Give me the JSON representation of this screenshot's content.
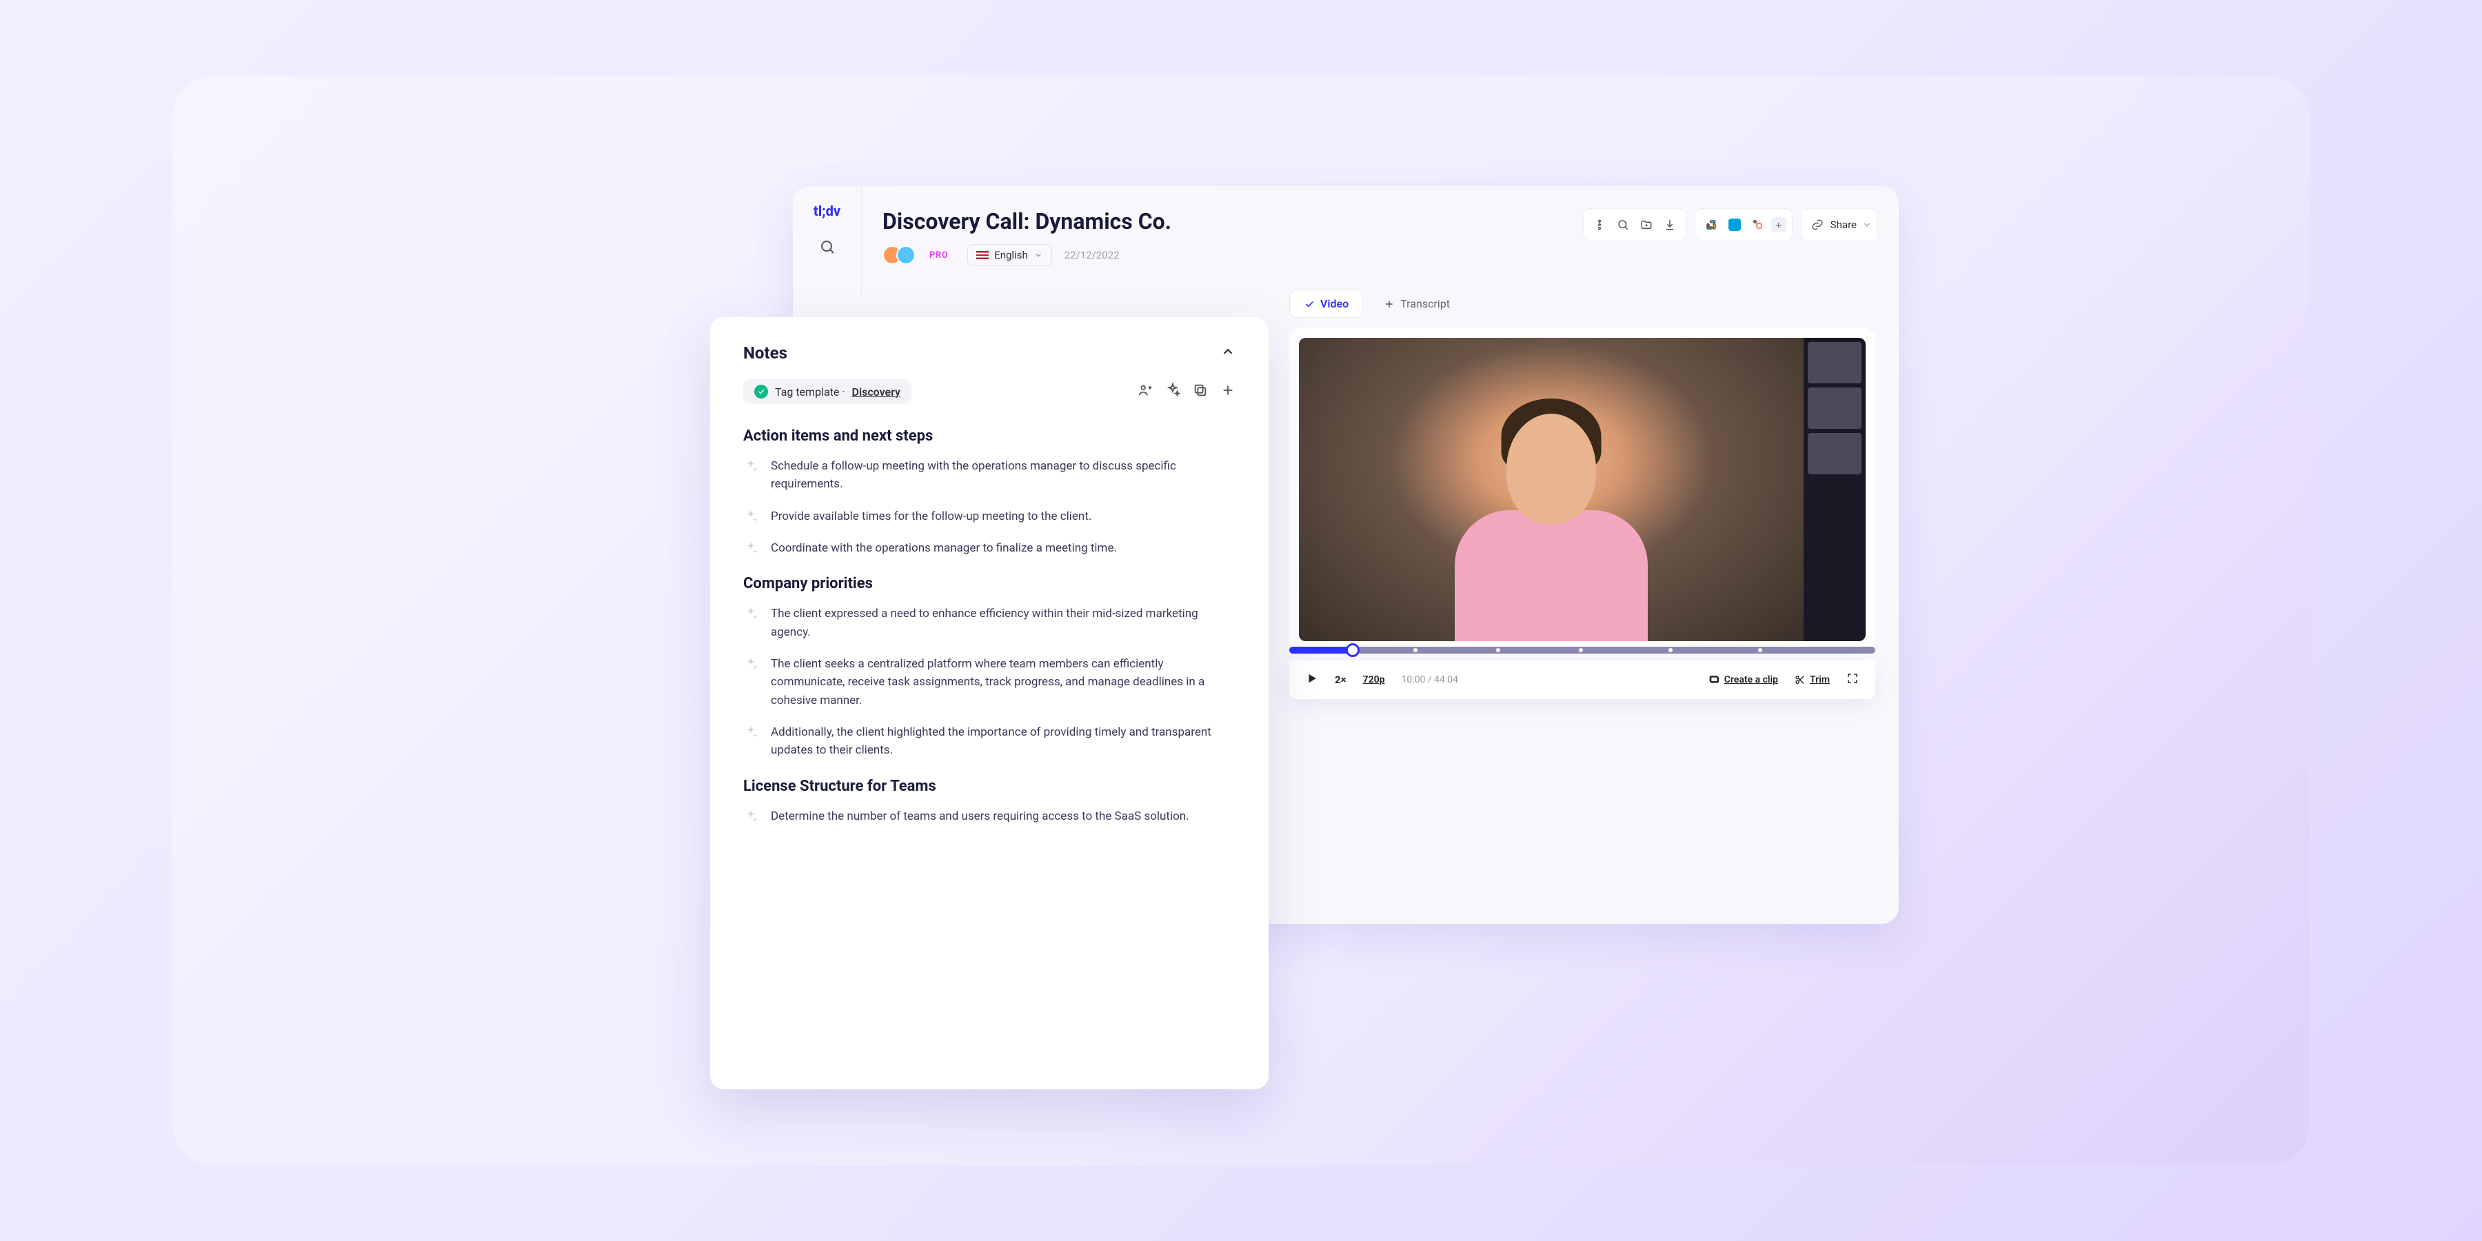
{
  "brand": "tl;dv",
  "page": {
    "title": "Discovery Call: Dynamics Co.",
    "badge": "PRO",
    "language": "English",
    "date": "22/12/2022"
  },
  "toolbar": {
    "share": "Share"
  },
  "tabs": {
    "video": "Video",
    "transcript": "Transcript"
  },
  "video": {
    "speed": "2×",
    "quality": "720p",
    "current_time": "10:00",
    "total_time": "44:04",
    "time_display": "10:00 / 44:04",
    "create_clip": "Create a clip",
    "trim": "Trim"
  },
  "notes": {
    "title": "Notes",
    "tag_label": "Tag template ·",
    "tag_name": "Discovery",
    "sections": [
      {
        "heading": "Action items and next steps",
        "items": [
          "Schedule a follow-up meeting with the operations manager to discuss specific requirements.",
          "Provide available times for the follow-up meeting to the client.",
          "Coordinate with the operations manager to finalize a meeting time."
        ]
      },
      {
        "heading": "Company priorities",
        "items": [
          "The client expressed a need to enhance efficiency within their mid-sized marketing agency.",
          "The client seeks a centralized platform where team members can efficiently communicate, receive task assignments, track progress, and manage deadlines in a cohesive manner.",
          "Additionally, the client highlighted the importance of providing timely and transparent updates to their clients."
        ]
      },
      {
        "heading": "License Structure for Teams",
        "items": [
          "Determine the number of teams and users requiring access to the SaaS solution."
        ]
      }
    ]
  }
}
